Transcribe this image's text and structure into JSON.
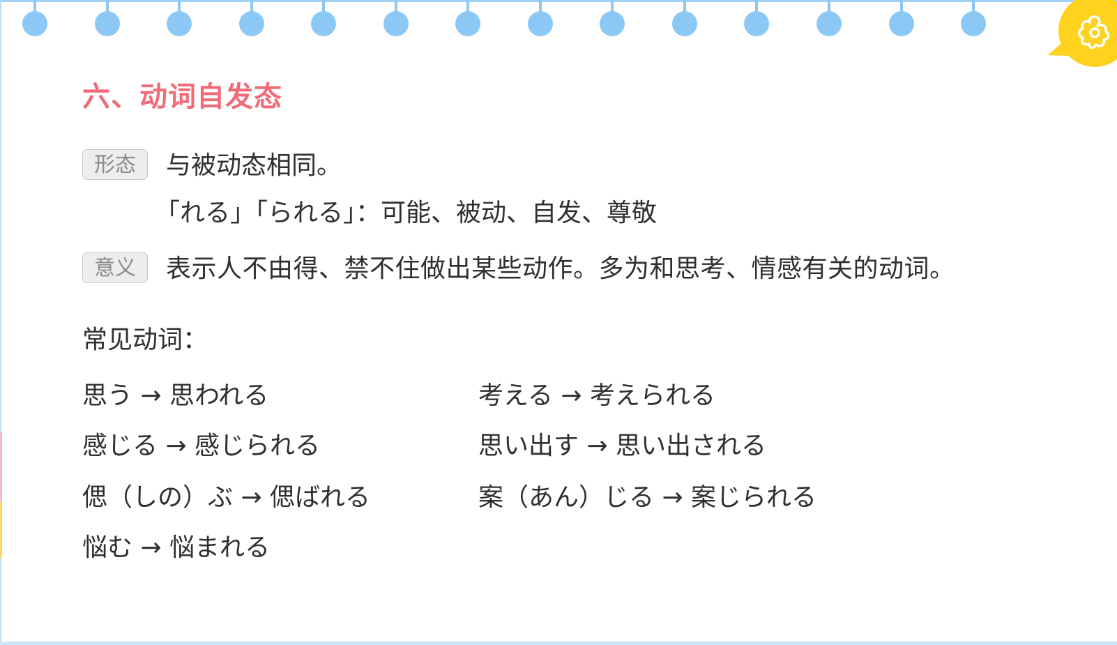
{
  "title": "六、动词自发态",
  "form": {
    "tag": "形态",
    "line1": "与被动态相同。",
    "line2": "「れる」「られる」：可能、被动、自发、尊敬"
  },
  "meaning": {
    "tag": "意义",
    "line": "表示人不由得、禁不住做出某些动作。多为和思考、情感有关的动词。"
  },
  "common_heading": "常见动词：",
  "verbs": {
    "left": [
      "思う → 思われる",
      "感じる → 感じられる",
      "偲（しの）ぶ → 偲ばれる",
      "悩む → 悩まれる"
    ],
    "right": [
      "考える → 考えられる",
      "思い出す → 思い出される",
      "案（あん）じる → 案じられる"
    ]
  },
  "colors": {
    "title": "#ef6b78",
    "rings": "#8cc8f6",
    "badge": "#ffd21e",
    "tag_bg": "#ededed"
  }
}
